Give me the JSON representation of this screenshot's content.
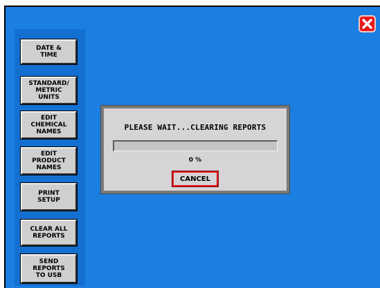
{
  "colors": {
    "background": "#1a7fe0",
    "sidebar": "#1470d0",
    "button_face": "#cfcfcf",
    "dialog_face": "#d6d4d6",
    "close_red": "#e81a1a",
    "cancel_border": "#e01818"
  },
  "window": {
    "close_icon": "close-x-icon"
  },
  "sidebar": {
    "items": [
      {
        "label": "DATE &\nTIME"
      },
      {
        "label": "STANDARD/\nMETRIC\nUNITS"
      },
      {
        "label": "EDIT\nCHEMICAL\nNAMES"
      },
      {
        "label": "EDIT\nPRODUCT\nNAMES"
      },
      {
        "label": "PRINT\nSETUP"
      },
      {
        "label": "CLEAR ALL\nREPORTS"
      },
      {
        "label": "SEND\nREPORTS\nTO USB"
      }
    ]
  },
  "dialog": {
    "title": "PLEASE WAIT...CLEARING REPORTS",
    "progress_percent": 0,
    "progress_text": "0 %",
    "cancel_label": "CANCEL"
  }
}
